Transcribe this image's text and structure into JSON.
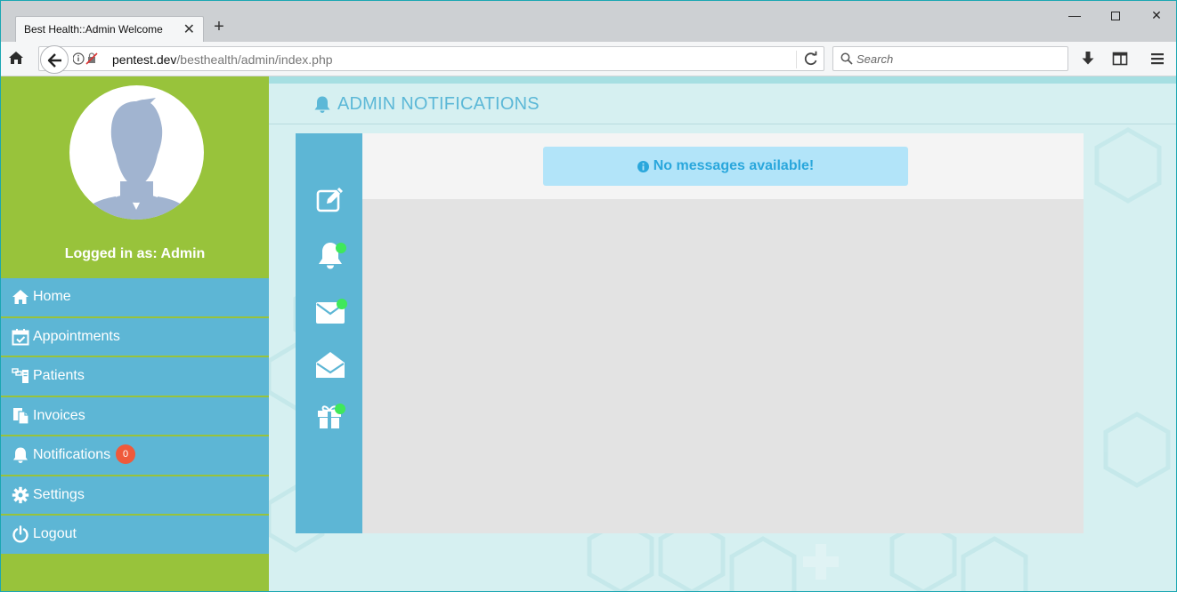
{
  "browser": {
    "tab_title": "Best Health::Admin Welcome",
    "tab_close": "✕",
    "new_tab": "+",
    "url_host": "pentest.dev",
    "url_path": "/besthealth/admin/index.php",
    "search_placeholder": "Search",
    "window_controls": {
      "minimize": "—",
      "close": "✕"
    }
  },
  "sidebar": {
    "logged_in_text": "Logged in as: Admin",
    "menu": [
      {
        "label": "Home",
        "icon": "home-icon"
      },
      {
        "label": "Appointments",
        "icon": "calendar-check-icon"
      },
      {
        "label": "Patients",
        "icon": "patients-icon"
      },
      {
        "label": "Invoices",
        "icon": "invoice-icon"
      },
      {
        "label": "Notifications",
        "icon": "bell-icon",
        "badge": "0"
      },
      {
        "label": "Settings",
        "icon": "gear-icon"
      },
      {
        "label": "Logout",
        "icon": "power-icon"
      }
    ]
  },
  "main": {
    "page_title": "ADMIN NOTIFICATIONS",
    "alert_text": "No messages available!",
    "side_icons": [
      "compose-icon",
      "bell-icon",
      "envelope-icon",
      "envelope-open-icon",
      "gift-icon"
    ]
  },
  "colors": {
    "sidebar_green": "#98c33b",
    "menu_blue": "#5db6d5",
    "badge_red": "#ef5a3b",
    "status_dot": "#3fe85a",
    "alert_bg": "#b2e4f9",
    "alert_text": "#2aa7dc"
  }
}
